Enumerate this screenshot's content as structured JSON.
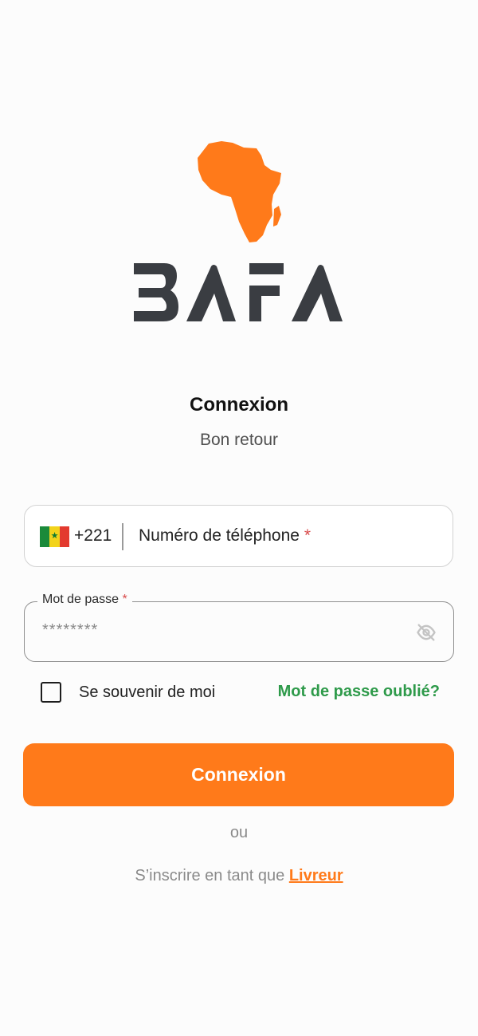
{
  "brand": {
    "name": "BAFA",
    "colors": {
      "orange": "#ff7a1a",
      "dark": "#3a3d42",
      "green": "#2e9a4a"
    }
  },
  "header": {
    "title": "Connexion",
    "subtitle": "Bon retour"
  },
  "phone": {
    "country_code": "+221",
    "placeholder": "Numéro de téléphone",
    "required_mark": "*",
    "flag": "senegal-flag"
  },
  "password": {
    "label": "Mot de passe",
    "required_mark": "*",
    "value": "********",
    "toggle_icon": "eye-off-icon"
  },
  "options": {
    "remember_label": "Se souvenir de moi",
    "remember_checked": false,
    "forgot_label": "Mot de passe oublié?"
  },
  "actions": {
    "login_label": "Connexion",
    "or_label": "ou",
    "signup_prefix": "S’inscrire en tant que ",
    "signup_link": "Livreur"
  }
}
